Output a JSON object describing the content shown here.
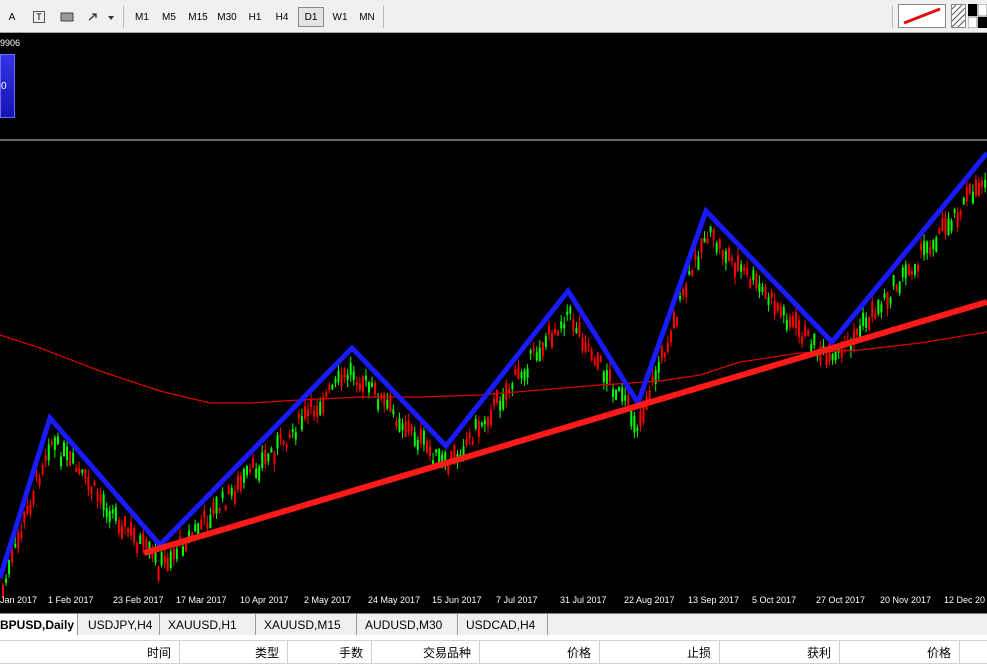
{
  "toolbar": {
    "tool_a": "A",
    "tool_t": "T",
    "timeframes": [
      "M1",
      "M5",
      "M15",
      "M30",
      "H1",
      "H4",
      "D1",
      "W1",
      "MN"
    ],
    "active_timeframe": "D1"
  },
  "chart": {
    "price_label": "9906",
    "box_label": "0",
    "date_labels": [
      "Jan 2017",
      "1 Feb 2017",
      "23 Feb 2017",
      "17 Mar 2017",
      "10 Apr 2017",
      "2 May 2017",
      "24 May 2017",
      "15 Jun 2017",
      "7 Jul 2017",
      "31 Jul 2017",
      "22 Aug 2017",
      "13 Sep 2017",
      "5 Oct 2017",
      "27 Oct 2017",
      "20 Nov 2017",
      "12 Dec 20"
    ],
    "colors": {
      "background": "#000000",
      "bull": "#00ff00",
      "bear": "#ff0000",
      "moving_average": "#e00000",
      "zigzag": "#1a1aff",
      "trendline": "#ff1a1a"
    }
  },
  "tabs": {
    "items": [
      "BPUSD,Daily",
      "USDJPY,H4",
      "XAUUSD,H1",
      "XAUUSD,M15",
      "AUDUSD,M30",
      "USDCAD,H4"
    ],
    "active": "BPUSD,Daily"
  },
  "terminal": {
    "columns": [
      "时间",
      "类型",
      "手数",
      "交易品种",
      "价格",
      "止损",
      "获利",
      "价格"
    ]
  }
}
